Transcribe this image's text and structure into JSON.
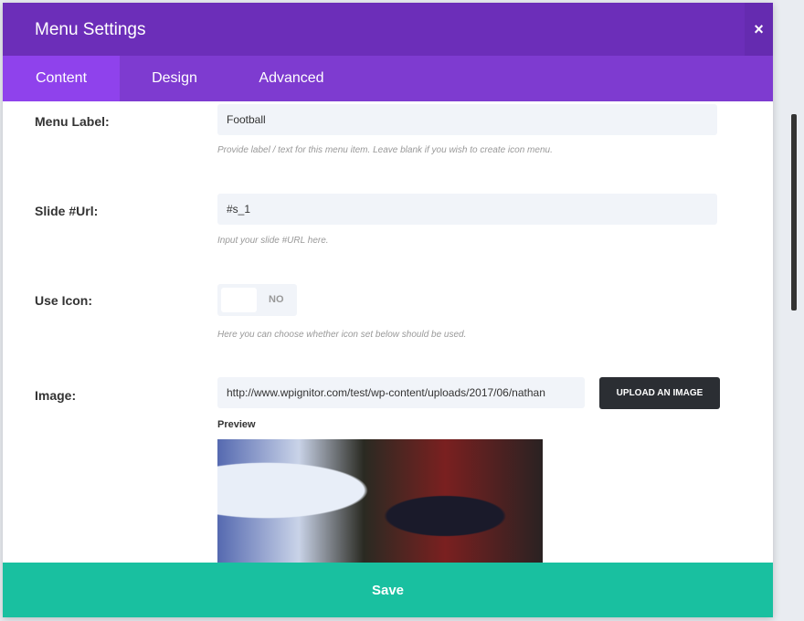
{
  "header": {
    "title": "Menu Settings",
    "close_icon": "×"
  },
  "tabs": [
    {
      "label": "Content"
    },
    {
      "label": "Design"
    },
    {
      "label": "Advanced"
    }
  ],
  "fields": {
    "menu_label": {
      "label": "Menu Label:",
      "value": "Football",
      "hint": "Provide label / text for this menu item. Leave blank if you wish to create icon menu."
    },
    "slide_url": {
      "label": "Slide #Url:",
      "value": "#s_1",
      "hint": "Input your slide #URL here."
    },
    "use_icon": {
      "label": "Use Icon:",
      "state": "NO",
      "hint": "Here you can choose whether icon set below should be used."
    },
    "image": {
      "label": "Image:",
      "value": "http://www.wpignitor.com/test/wp-content/uploads/2017/06/nathan",
      "button": "UPLOAD AN IMAGE",
      "preview_label": "Preview"
    }
  },
  "footer": {
    "save": "Save"
  }
}
